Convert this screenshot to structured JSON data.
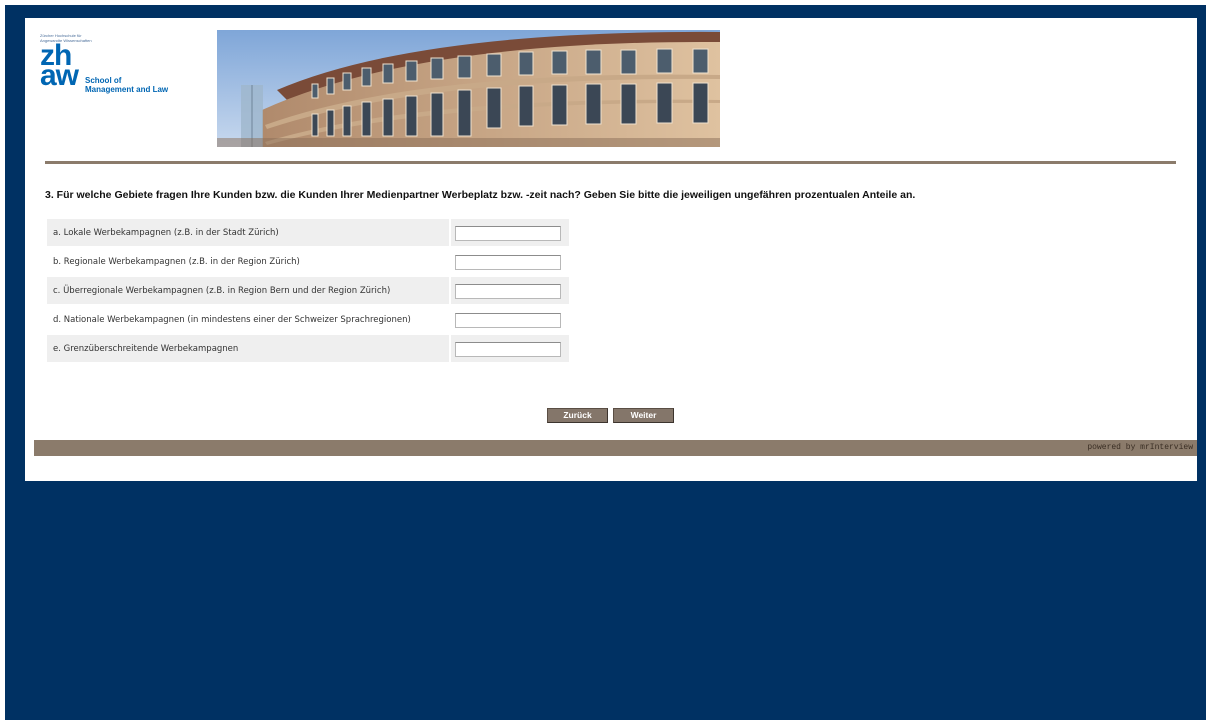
{
  "logo": {
    "tagline_small": "Zürcher Hochschule für Angewandte Wissenschaften",
    "mark_top": "zh",
    "mark_bottom": "aw",
    "school_line1": "School of",
    "school_line2": "Management and Law",
    "brand_color": "#0066b3"
  },
  "question": {
    "text": "3. Für welche Gebiete fragen Ihre Kunden bzw. die Kunden Ihrer Medienpartner Werbeplatz bzw. -zeit nach? Geben Sie bitte die jeweiligen ungefähren prozentualen Anteile an."
  },
  "rows": [
    {
      "label": "a. Lokale Werbekampagnen  (z.B. in der Stadt Zürich)",
      "value": ""
    },
    {
      "label": "b. Regionale Werbekampagnen  (z.B. in der Region Zürich)",
      "value": ""
    },
    {
      "label": "c. Überregionale Werbekampagnen  (z.B. in Region Bern und der Region Zürich)",
      "value": ""
    },
    {
      "label": "d. Nationale Werbekampagnen (in mindestens einer der Schweizer Sprachregionen)",
      "value": ""
    },
    {
      "label": "e. Grenzüberschreitende Werbekampagnen",
      "value": ""
    }
  ],
  "nav": {
    "back_label": "Zurück",
    "next_label": "Weiter"
  },
  "footer": {
    "powered_by": "powered by mrInterview"
  },
  "colors": {
    "page_background": "#003163",
    "accent_brown": "#8b7b6b",
    "button": "#84766a"
  }
}
